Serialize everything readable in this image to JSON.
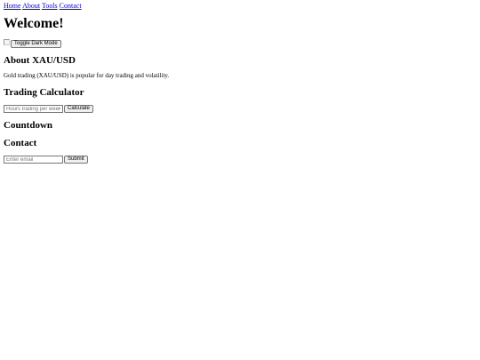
{
  "nav": {
    "items": [
      {
        "label": "Home"
      },
      {
        "label": "About"
      },
      {
        "label": "Tools"
      },
      {
        "label": "Contact"
      }
    ]
  },
  "header": {
    "title": "Welcome!",
    "dark_mode_button": "Toggle Dark Mode"
  },
  "about": {
    "heading": "About XAU/USD",
    "text": "Gold trading (XAU/USD) is popular for day trading and volatility."
  },
  "calculator": {
    "heading": "Trading Calculator",
    "input_placeholder": "Hours trading per week",
    "button_label": "Calculate"
  },
  "countdown": {
    "heading": "Countdown"
  },
  "contact": {
    "heading": "Contact",
    "email_placeholder": "Enter email",
    "submit_label": "Submit"
  }
}
